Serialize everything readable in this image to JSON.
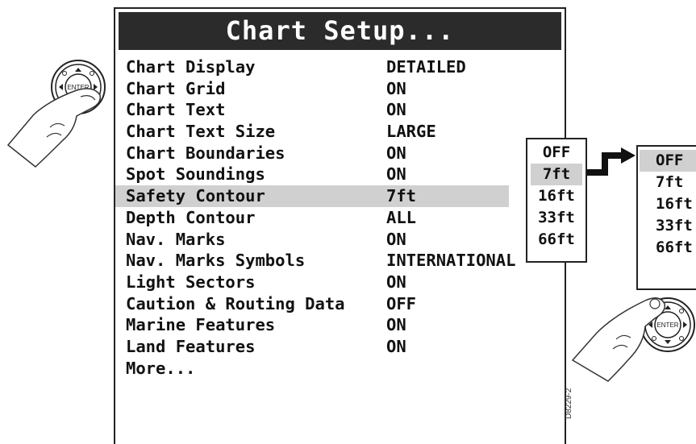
{
  "screen": {
    "title": "Chart Setup...",
    "items": [
      {
        "label": "Chart Display",
        "value": "DETAILED"
      },
      {
        "label": "Chart Grid",
        "value": "ON"
      },
      {
        "label": "Chart Text",
        "value": "ON"
      },
      {
        "label": "Chart Text Size",
        "value": "LARGE"
      },
      {
        "label": "Chart Boundaries",
        "value": "ON"
      },
      {
        "label": "Spot Soundings",
        "value": "ON"
      },
      {
        "label": "Safety Contour",
        "value": "7ft"
      },
      {
        "label": "Depth Contour",
        "value": "ALL"
      },
      {
        "label": "Nav. Marks",
        "value": "ON"
      },
      {
        "label": "Nav. Marks Symbols",
        "value": "INTERNATIONAL"
      },
      {
        "label": "Light Sectors",
        "value": "ON"
      },
      {
        "label": "Caution & Routing Data",
        "value": "OFF"
      },
      {
        "label": "Marine Features",
        "value": "ON"
      },
      {
        "label": "Land Features",
        "value": "ON"
      },
      {
        "label": "More...",
        "value": ""
      }
    ],
    "selected_index": 6
  },
  "popup_before": {
    "options": [
      "OFF",
      "7ft",
      "16ft",
      "33ft",
      "66ft"
    ],
    "selected_index": 1
  },
  "popup_after": {
    "options": [
      "OFF",
      "7ft",
      "16ft",
      "33ft",
      "66ft"
    ],
    "selected_index": 0
  },
  "enter_button_label": "ENTER",
  "figure_ref": "D8229-2"
}
